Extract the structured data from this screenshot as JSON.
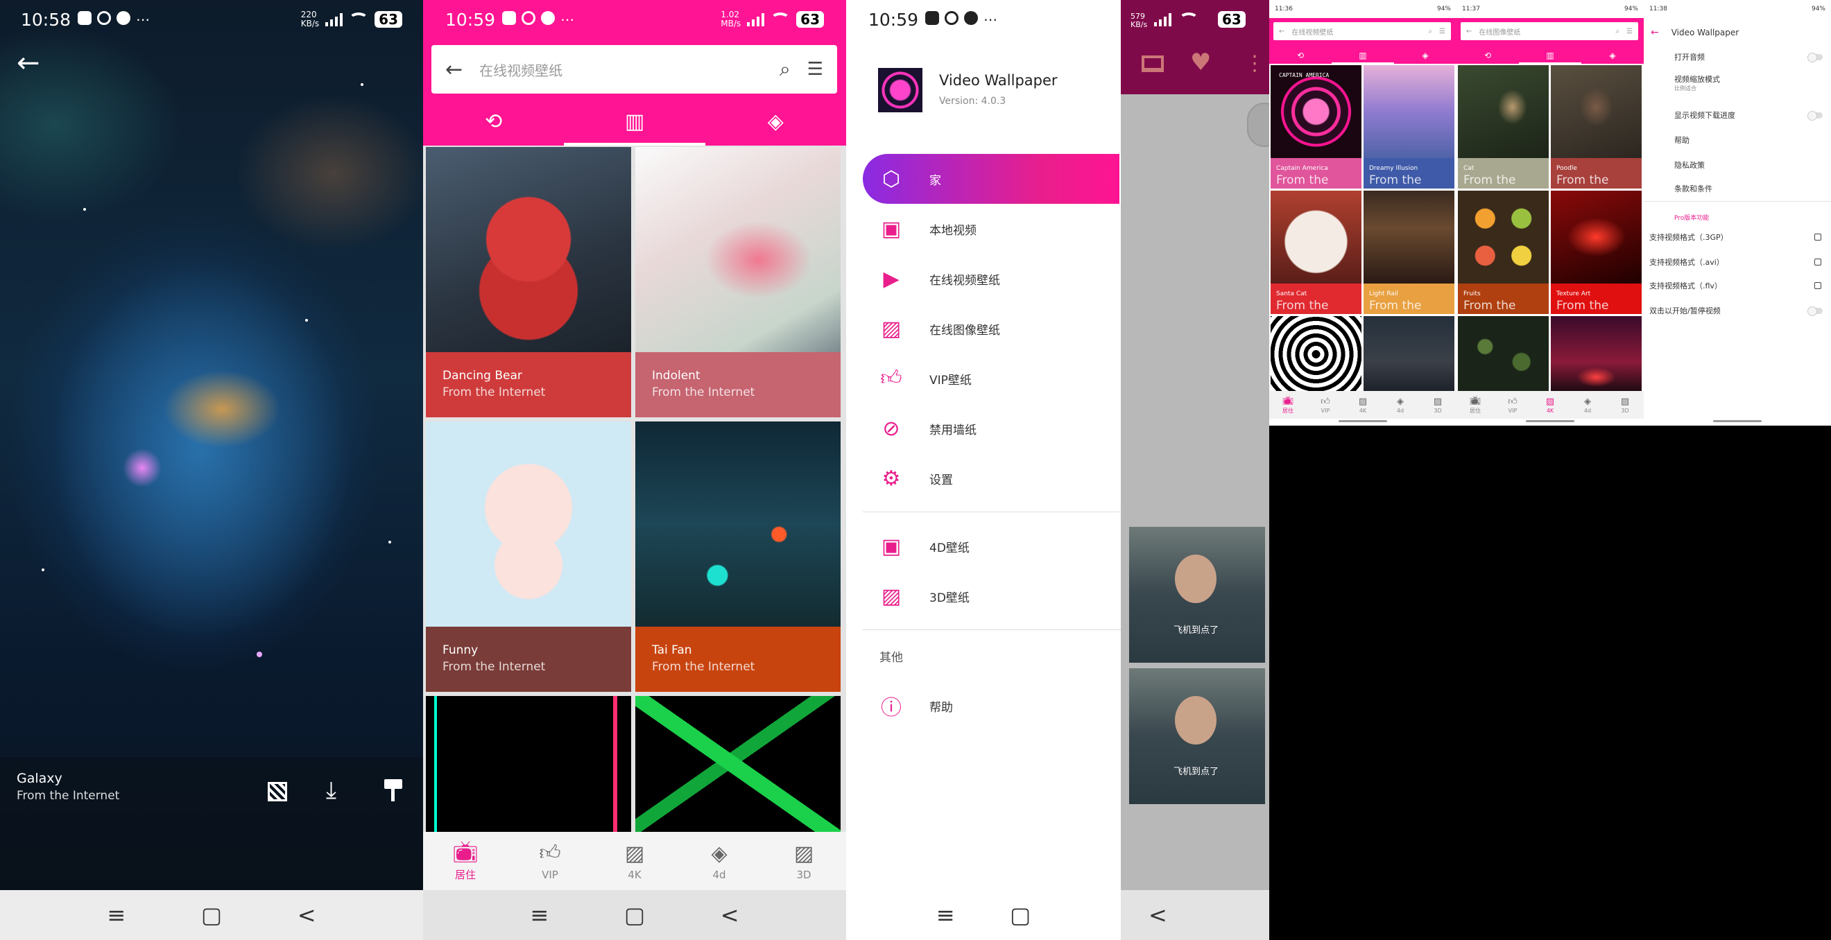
{
  "colors": {
    "brand": "#ff1493",
    "accent_purple": "#8a2be2",
    "card_red": "#cf3b3b",
    "card_rose": "#c66470",
    "card_brown": "#7a3c38",
    "card_orange": "#c8440f"
  },
  "panel_galaxy": {
    "status": {
      "time": "10:58",
      "net_speed_top": "220",
      "net_speed_bottom": "KB/s",
      "battery": "63"
    },
    "title": "Galaxy",
    "subtitle": "From the Internet",
    "icons": [
      "back-arrow-icon",
      "checker-icon",
      "download-icon",
      "paint-roller-icon"
    ],
    "nav": [
      "≡",
      "▢",
      "<"
    ]
  },
  "panel_online": {
    "status": {
      "time": "10:59",
      "net_speed_top": "1.02",
      "net_speed_bottom": "MB/s",
      "battery": "63"
    },
    "search_placeholder": "在线视频壁纸",
    "tabs": [
      "history-icon",
      "gallery-icon",
      "layers-icon"
    ],
    "cards": [
      {
        "title": "Dancing Bear",
        "source": "From the Internet"
      },
      {
        "title": "Indolent",
        "source": "From the Internet"
      },
      {
        "title": "Funny",
        "source": "From the Internet"
      },
      {
        "title": "Tai Fan",
        "source": "From the Internet"
      }
    ],
    "bottom_nav": [
      {
        "label": "居住",
        "icon": "tv-icon",
        "active": true
      },
      {
        "label": "VIP",
        "icon": "thumb-up-icon",
        "active": false
      },
      {
        "label": "4K",
        "icon": "image-icon",
        "active": false
      },
      {
        "label": "4d",
        "icon": "layers-icon",
        "active": false
      },
      {
        "label": "3D",
        "icon": "image-icon",
        "active": false
      }
    ],
    "nav": [
      "≡",
      "▢",
      "<"
    ]
  },
  "panel_drawer": {
    "status": {
      "time": "10:59"
    },
    "app_name": "Video Wallpaper",
    "version": "Version: 4.0.3",
    "items": [
      {
        "label": "家",
        "icon": "cube-icon",
        "active": true
      },
      {
        "label": "本地视频",
        "icon": "film-icon"
      },
      {
        "label": "在线视频壁纸",
        "icon": "film-play-icon"
      },
      {
        "label": "在线图像壁纸",
        "icon": "image-icon"
      },
      {
        "label": "VIP壁纸",
        "icon": "thumb-up-icon"
      },
      {
        "label": "禁用墙纸",
        "icon": "block-icon"
      },
      {
        "label": "设置",
        "icon": "gear-icon"
      }
    ],
    "items2": [
      {
        "label": "4D壁纸",
        "icon": "film-icon"
      },
      {
        "label": "3D壁纸",
        "icon": "image-icon"
      }
    ],
    "section_other": "其他",
    "help": {
      "label": "帮助",
      "icon": "help-icon"
    },
    "nav": [
      "≡",
      "▢"
    ]
  },
  "panel_dim": {
    "status": {
      "net_speed_top": "579",
      "net_speed_bottom": "KB/s",
      "battery": "63"
    },
    "thumb_caption": "飞机到点了",
    "nav_back": "<"
  },
  "panel_mini_video": {
    "status": {
      "time": "11:36",
      "right": "94%"
    },
    "search_placeholder": "在线视频壁纸",
    "cards": [
      {
        "title": "Captain America",
        "source": "From the Internet",
        "banner": "CAPTAIN AMERICA"
      },
      {
        "title": "Dreamy Illusion",
        "source": "From the Internet"
      },
      {
        "title": "Santa Cat",
        "source": "From the Internet"
      },
      {
        "title": "Light Rail",
        "source": "From the Internet"
      }
    ],
    "bottom_nav": [
      {
        "label": "居住",
        "active": true
      },
      {
        "label": "VIP"
      },
      {
        "label": "4K"
      },
      {
        "label": "4d"
      },
      {
        "label": "3D"
      }
    ]
  },
  "panel_mini_image": {
    "status": {
      "time": "11:37",
      "right": "94%"
    },
    "search_placeholder": "在线图像壁纸",
    "cards": [
      {
        "title": "Cat",
        "source": "From the Internet"
      },
      {
        "title": "Poodle",
        "source": "From the Internet"
      },
      {
        "title": "Fruits",
        "source": "From the Internet"
      },
      {
        "title": "Texture Art",
        "source": "From the Internet"
      }
    ],
    "bottom_nav": [
      {
        "label": "居住"
      },
      {
        "label": "VIP"
      },
      {
        "label": "4K",
        "active": true
      },
      {
        "label": "4d"
      },
      {
        "label": "3D"
      }
    ]
  },
  "panel_settings": {
    "status": {
      "time": "11:38",
      "right": "94%"
    },
    "title": "Video Wallpaper",
    "rows": [
      {
        "label": "打开音频",
        "control": "toggle"
      },
      {
        "label": "视频缩放模式",
        "sub": "比例适合"
      },
      {
        "label": "显示视频下载进度",
        "control": "toggle"
      },
      {
        "label": "帮助"
      },
      {
        "label": "隐私政策"
      },
      {
        "label": "条款和条件"
      }
    ],
    "pro_header": "Pro版本功能",
    "pro_rows": [
      {
        "label": "支持视频格式（.3GP）",
        "control": "checkbox"
      },
      {
        "label": "支持视频格式（.avi）",
        "control": "checkbox"
      },
      {
        "label": "支持视频格式（.flv）",
        "control": "checkbox"
      },
      {
        "label": "双击以开始/暂停视频",
        "control": "toggle"
      }
    ]
  }
}
